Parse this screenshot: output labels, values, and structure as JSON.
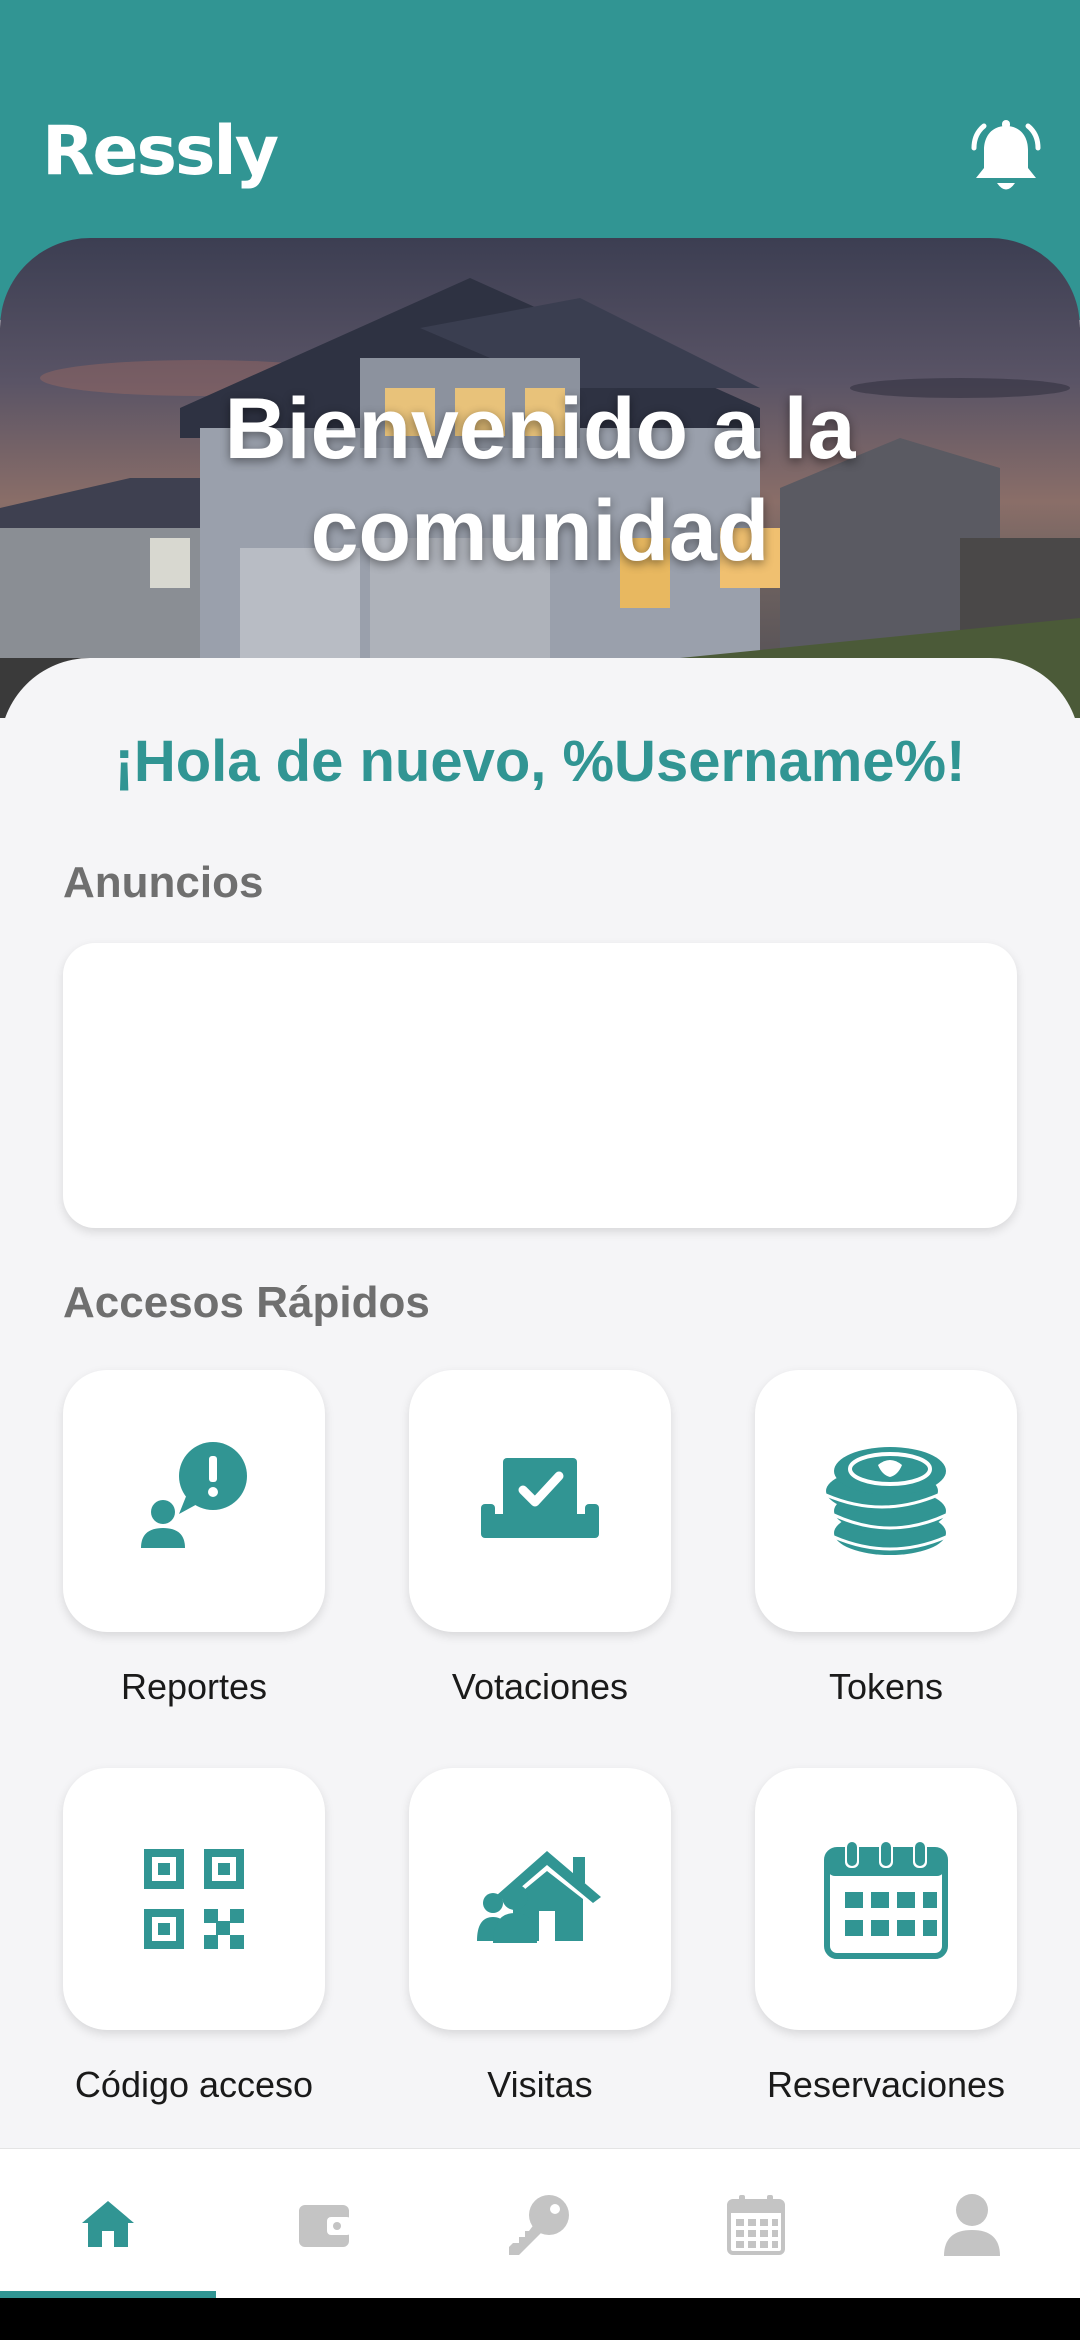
{
  "header": {
    "logo_text": "Ressly",
    "bell_icon": "bell-icon",
    "background_color": "#319593"
  },
  "hero": {
    "title_line1": "Bienvenido a la",
    "title_line2": "comunidad"
  },
  "greeting": "¡Hola de nuevo, %Username%!",
  "announcements": {
    "title": "Anuncios",
    "items": []
  },
  "quick_access": {
    "title": "Accesos Rápidos",
    "items": [
      {
        "label": "Reportes",
        "icon": "report-user-alert-icon"
      },
      {
        "label": "Votaciones",
        "icon": "ballot-box-icon"
      },
      {
        "label": "Tokens",
        "icon": "coins-icon"
      },
      {
        "label": "Código acceso",
        "icon": "qr-code-icon"
      },
      {
        "label": "Visitas",
        "icon": "visitors-house-icon"
      },
      {
        "label": "Reservaciones",
        "icon": "calendar-icon"
      }
    ]
  },
  "bottom_nav": {
    "active_index": 0,
    "items": [
      {
        "icon": "home-icon"
      },
      {
        "icon": "wallet-icon"
      },
      {
        "icon": "key-icon"
      },
      {
        "icon": "calendar-icon"
      },
      {
        "icon": "profile-icon"
      }
    ]
  },
  "colors": {
    "accent": "#319593",
    "muted_icon": "#c4c4c4",
    "section_title": "#6f6f6f"
  }
}
